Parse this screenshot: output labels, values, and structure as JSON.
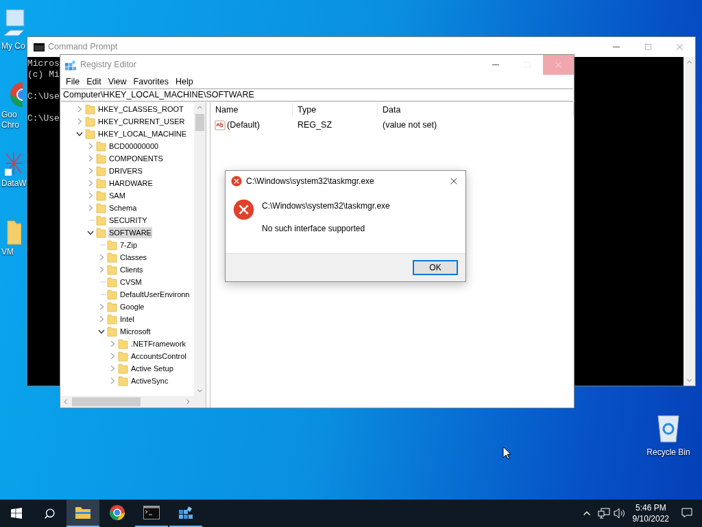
{
  "desktop_icons": [
    {
      "kind": "computer",
      "label_lines": [
        "My Co"
      ]
    },
    {
      "kind": "browser",
      "label_lines": [
        "Goo",
        "Chro"
      ]
    },
    {
      "kind": "network",
      "label_lines": [
        "DataW"
      ]
    },
    {
      "kind": "folder",
      "label_lines": [
        "VM"
      ]
    }
  ],
  "recycle_bin": {
    "label": "Recycle Bin"
  },
  "command_prompt": {
    "title": "Command Prompt",
    "paragraphs": [
      [
        "Micros",
        "(c) Mi"
      ],
      [
        "C:\\Use"
      ],
      [
        "C:\\Use"
      ]
    ]
  },
  "registry_editor": {
    "title": "Registry Editor",
    "maximize_disabled": true,
    "close_highlighted": true,
    "menu": [
      "File",
      "Edit",
      "View",
      "Favorites",
      "Help"
    ],
    "address": "Computer\\HKEY_LOCAL_MACHINE\\SOFTWARE",
    "tree": [
      {
        "label": "HKEY_CLASSES_ROOT",
        "kind": "branch",
        "expanded": false,
        "selected": false
      },
      {
        "label": "HKEY_CURRENT_USER",
        "kind": "branch",
        "expanded": false,
        "selected": false
      },
      {
        "label": "HKEY_LOCAL_MACHINE",
        "kind": "branch",
        "expanded": true,
        "selected": false,
        "children": [
          {
            "label": "BCD00000000",
            "kind": "branch",
            "expanded": false,
            "selected": false
          },
          {
            "label": "COMPONENTS",
            "kind": "branch",
            "expanded": false,
            "selected": false
          },
          {
            "label": "DRIVERS",
            "kind": "branch",
            "expanded": false,
            "selected": false
          },
          {
            "label": "HARDWARE",
            "kind": "branch",
            "expanded": false,
            "selected": false
          },
          {
            "label": "SAM",
            "kind": "branch",
            "expanded": false,
            "selected": false
          },
          {
            "label": "Schema",
            "kind": "branch",
            "expanded": false,
            "selected": false
          },
          {
            "label": "SECURITY",
            "kind": "leaf",
            "selected": false
          },
          {
            "label": "SOFTWARE",
            "kind": "branch",
            "expanded": true,
            "selected": true,
            "children": [
              {
                "label": "7-Zip",
                "kind": "leaf",
                "selected": false
              },
              {
                "label": "Classes",
                "kind": "branch",
                "expanded": false,
                "selected": false
              },
              {
                "label": "Clients",
                "kind": "branch",
                "expanded": false,
                "selected": false
              },
              {
                "label": "CVSM",
                "kind": "leaf",
                "selected": false
              },
              {
                "label": "DefaultUserEnvironn",
                "kind": "leaf",
                "selected": false
              },
              {
                "label": "Google",
                "kind": "branch",
                "expanded": false,
                "selected": false
              },
              {
                "label": "Intel",
                "kind": "branch",
                "expanded": false,
                "selected": false
              },
              {
                "label": "Microsoft",
                "kind": "branch",
                "expanded": true,
                "selected": false,
                "children": [
                  {
                    "label": ".NETFramework",
                    "kind": "branch",
                    "expanded": false,
                    "selected": false
                  },
                  {
                    "label": "AccountsControl",
                    "kind": "branch",
                    "expanded": false,
                    "selected": false
                  },
                  {
                    "label": "Active Setup",
                    "kind": "branch",
                    "expanded": false,
                    "selected": false
                  },
                  {
                    "label": "ActiveSync",
                    "kind": "branch",
                    "expanded": false,
                    "selected": false
                  }
                ]
              }
            ]
          }
        ]
      }
    ],
    "columns": [
      "Name",
      "Type",
      "Data"
    ],
    "rows": [
      {
        "name": "(Default)",
        "type": "REG_SZ",
        "data": "(value not set)"
      }
    ]
  },
  "dialog": {
    "title": "C:\\Windows\\system32\\taskmgr.exe",
    "heading": "C:\\Windows\\system32\\taskmgr.exe",
    "message": "No such interface supported",
    "button": "OK"
  },
  "taskbar": {
    "apps": [
      {
        "kind": "explorer",
        "running": true,
        "active": true
      },
      {
        "kind": "browser",
        "running": false,
        "active": false
      },
      {
        "kind": "terminal",
        "running": true,
        "active": false
      },
      {
        "kind": "registry",
        "running": true,
        "active": false
      }
    ],
    "time": "5:46 PM",
    "date": "9/10/2022"
  }
}
